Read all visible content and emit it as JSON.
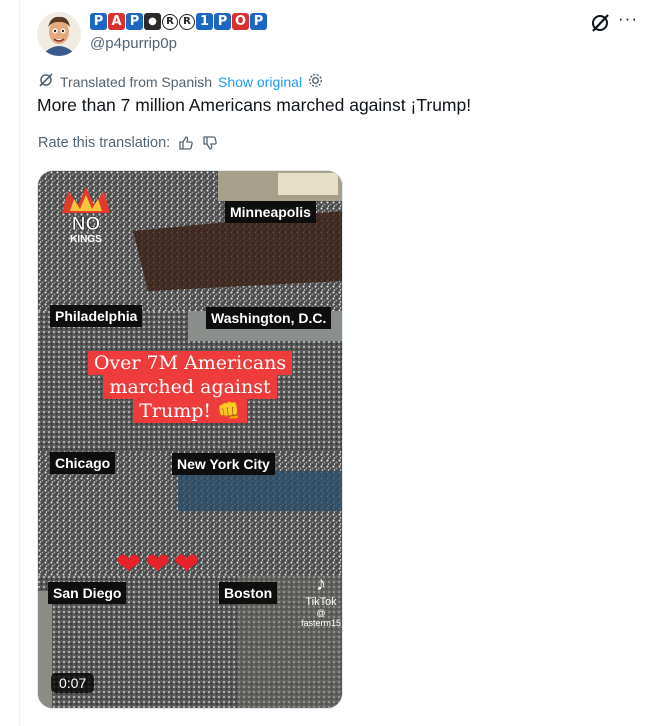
{
  "author": {
    "display_name_letters": [
      "P",
      "A",
      "P",
      "●",
      "R",
      "R",
      "1",
      "P",
      "O",
      "P"
    ],
    "handle": "@p4purrip0p"
  },
  "translation": {
    "note": "Translated from Spanish",
    "show_original": "Show original"
  },
  "tweet": {
    "text": "More than 7 million Americans marched against ¡Trump!"
  },
  "rating": {
    "label": "Rate this translation:"
  },
  "video": {
    "duration": "0:07",
    "overlay_logo": "NO KINGS",
    "headline_lines": [
      "Over 7M Americans",
      "marched against",
      "Trump! 👊"
    ],
    "cities": [
      "Minneapolis",
      "Philadelphia",
      "Washington, D.C.",
      "Chicago",
      "New York City",
      "San Diego",
      "Boston"
    ],
    "watermark": "TikTok",
    "watermark_user": "@ fasterm15",
    "hearts": [
      "❤",
      "❤",
      "❤"
    ]
  },
  "icons": {
    "grok": "grok-icon",
    "more": "more-icon",
    "translate": "translate-icon",
    "settings": "gear-icon",
    "thumbs_up": "thumbs-up-icon",
    "thumbs_down": "thumbs-down-icon"
  },
  "colors": {
    "link": "#1d9bf0",
    "secondary_text": "#536471",
    "headline_bg": "#ee3b3b"
  }
}
